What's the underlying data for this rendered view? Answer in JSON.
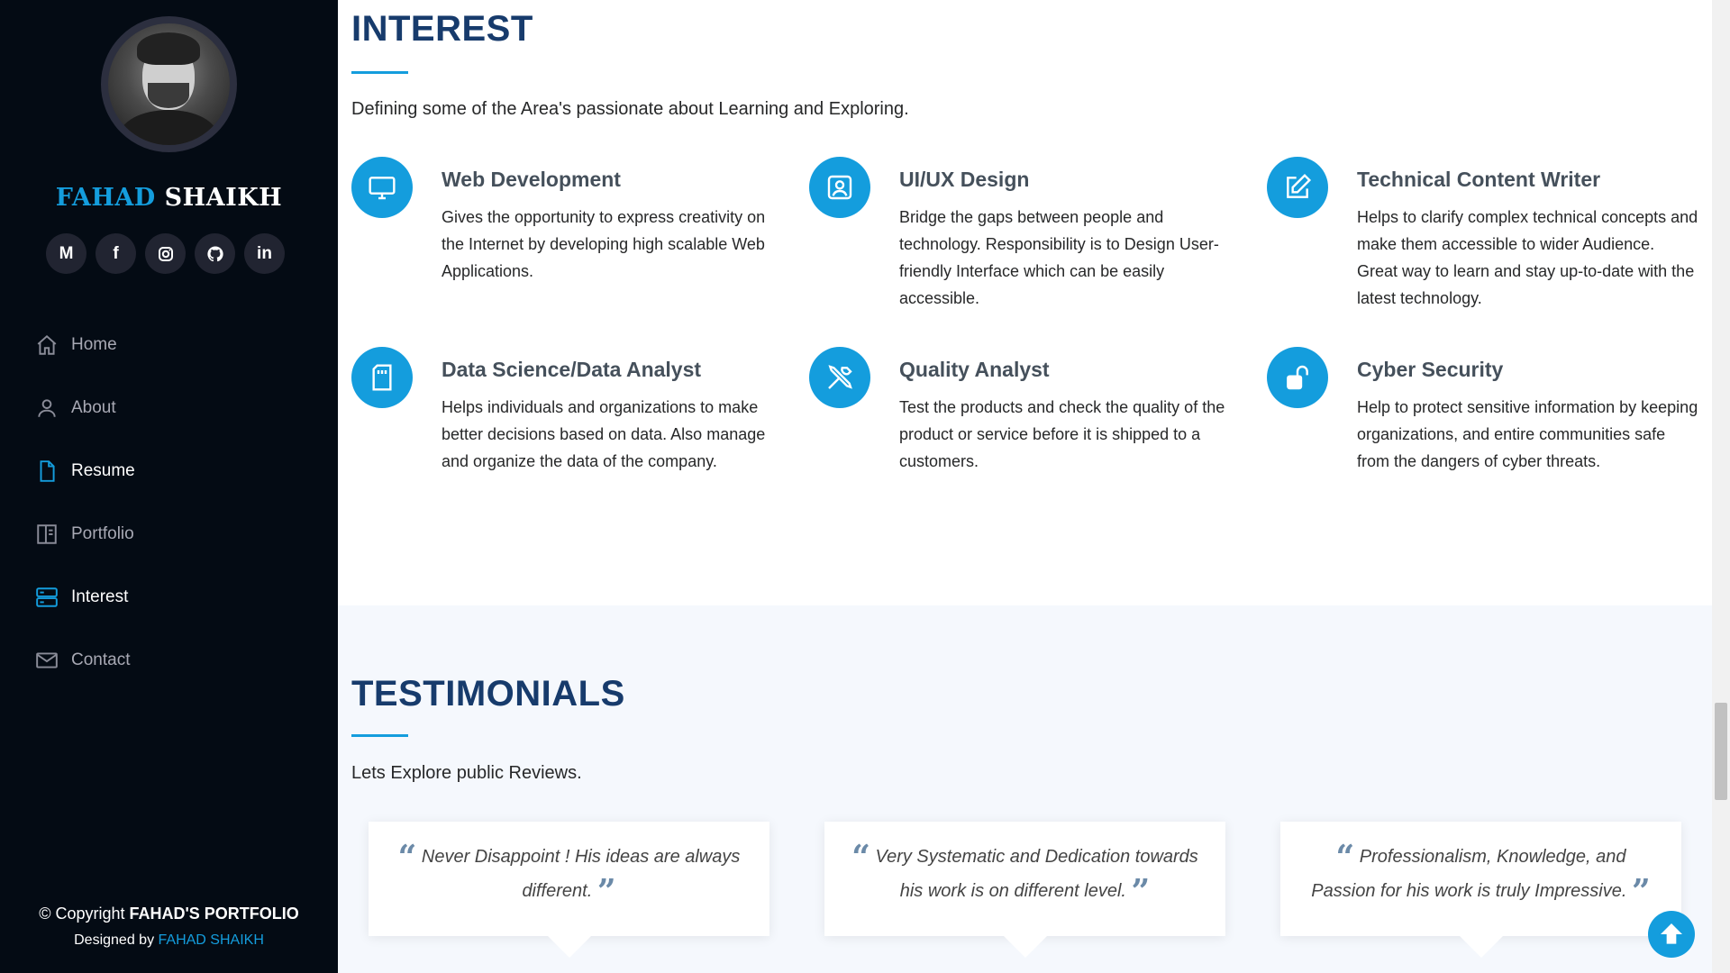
{
  "profile": {
    "first_name": "FAHAD",
    "last_name": "SHAIKH",
    "social": [
      {
        "icon": "gmail-icon",
        "glyph": "M"
      },
      {
        "icon": "facebook-icon",
        "glyph": "f"
      },
      {
        "icon": "instagram-icon",
        "glyph": ""
      },
      {
        "icon": "github-icon",
        "glyph": ""
      },
      {
        "icon": "linkedin-icon",
        "glyph": "in"
      }
    ]
  },
  "nav": [
    {
      "label": "Home",
      "icon": "home-icon"
    },
    {
      "label": "About",
      "icon": "person-icon"
    },
    {
      "label": "Resume",
      "icon": "file-icon"
    },
    {
      "label": "Portfolio",
      "icon": "book-icon"
    },
    {
      "label": "Interest",
      "icon": "server-icon"
    },
    {
      "label": "Contact",
      "icon": "envelope-icon"
    }
  ],
  "footer": {
    "copyright_prefix": "© Copyright ",
    "copyright_name": "FAHAD'S PORTFOLIO",
    "designed_prefix": "Designed by ",
    "designed_name": "FAHAD SHAIKH"
  },
  "interest": {
    "title": "INTEREST",
    "description": "Defining some of the Area's passionate about Learning and Exploring.",
    "items": [
      {
        "title": "Web Development",
        "icon": "monitor-icon",
        "text": "Gives the opportunity to express creativity on the Internet by developing high scalable Web Applications."
      },
      {
        "title": "UI/UX Design",
        "icon": "person-badge-icon",
        "text": "Bridge the gaps between people and technology. Responsibility is to Design User-friendly Interface which can be easily accessible."
      },
      {
        "title": "Technical Content Writer",
        "icon": "pencil-square-icon",
        "text": "Helps to clarify complex technical concepts and make them accessible to wider Audience. Great way to learn and stay up-to-date with the latest technology."
      },
      {
        "title": "Data Science/Data Analyst",
        "icon": "sd-card-icon",
        "text": "Helps individuals and organizations to make better decisions based on data. Also manage and organize the data of the company."
      },
      {
        "title": "Quality Analyst",
        "icon": "tools-icon",
        "text": "Test the products and check the quality of the product or service before it is shipped to a customers."
      },
      {
        "title": "Cyber Security",
        "icon": "unlock-icon",
        "text": "Help to protect sensitive information by keeping organizations, and entire communities safe from the dangers of cyber threats."
      }
    ]
  },
  "testimonials": {
    "title": "TESTIMONIALS",
    "description": "Lets Explore public Reviews.",
    "quotes": [
      {
        "text": "Never Disappoint ! His ideas are always different."
      },
      {
        "text": "Very Systematic and Dedication towards his work is on different level."
      },
      {
        "text": "Professionalism, Knowledge, and Passion for his work is truly Impressive."
      }
    ]
  },
  "colors": {
    "accent": "#149ddd",
    "title": "#173b6c",
    "sidebar_bg": "#040b14"
  }
}
